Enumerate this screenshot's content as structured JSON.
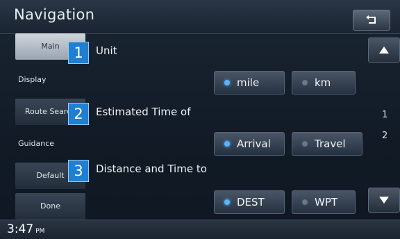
{
  "header": {
    "title": "Navigation",
    "back_icon": "return-icon"
  },
  "sidebar": {
    "items": [
      {
        "label": "Main"
      },
      {
        "label": "Display"
      },
      {
        "label": "Route Search"
      },
      {
        "label": "Guidance"
      },
      {
        "label": "Default"
      },
      {
        "label": "Done"
      }
    ]
  },
  "settings": [
    {
      "number": "1",
      "label": "Unit",
      "options": [
        "mile",
        "km"
      ],
      "selected": "mile"
    },
    {
      "number": "2",
      "label": "Estimated Time of",
      "options": [
        "Arrival",
        "Travel"
      ],
      "selected": "Arrival"
    },
    {
      "number": "3",
      "label": "Distance and Time to",
      "options": [
        "DEST",
        "WPT"
      ],
      "selected": "DEST"
    }
  ],
  "page": {
    "current": "1",
    "total": "2"
  },
  "status": {
    "time": "3:47",
    "ampm": "PM"
  }
}
